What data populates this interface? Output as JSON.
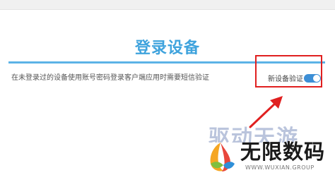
{
  "page": {
    "title": "登录设备",
    "description": "在未登录过的设备使用账号密码登录客户端应用时需要短信验证"
  },
  "setting": {
    "label": "新设备验证",
    "enabled": true
  },
  "watermark": {
    "secondary": "驱动天游",
    "brand": "无限数码",
    "url": "WWW.WUXIAN.GROUP"
  },
  "colors": {
    "accent": "#3fa3dd",
    "toggle_on": "#3d8fd6",
    "highlight": "#e02020"
  }
}
